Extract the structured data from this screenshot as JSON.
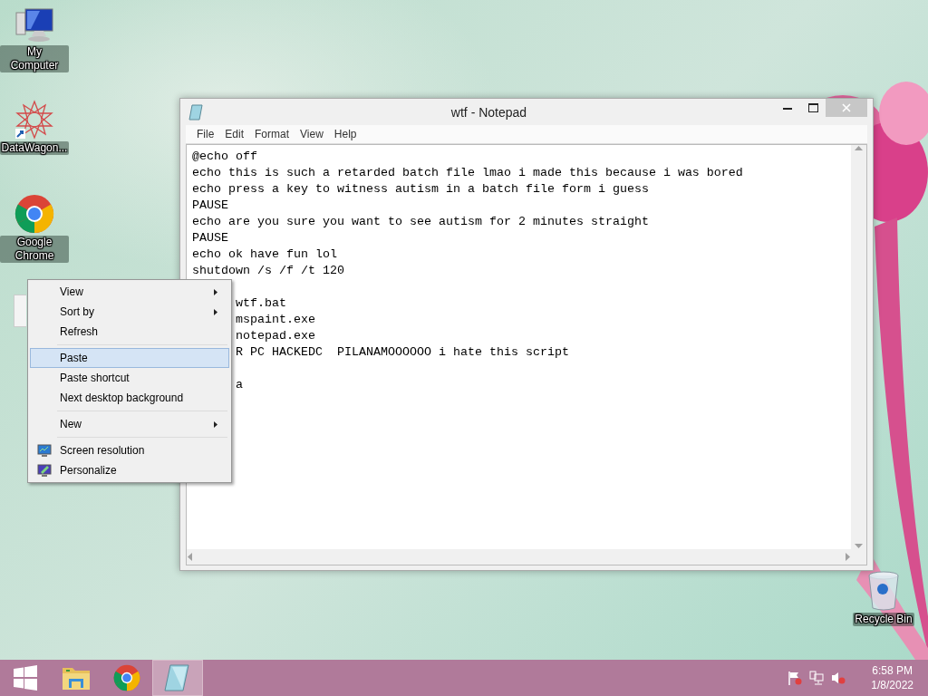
{
  "desktop_icons": [
    {
      "label": "My Computer",
      "kind": "computer"
    },
    {
      "label": "DataWagon...",
      "kind": "star"
    },
    {
      "label": "Google Chrome",
      "kind": "chrome"
    },
    {
      "label": "Recycle Bin",
      "kind": "bin"
    }
  ],
  "notepad": {
    "title": "wtf - Notepad",
    "menu": [
      "File",
      "Edit",
      "Format",
      "View",
      "Help"
    ],
    "lines": [
      {
        "kind": "full",
        "text": "@echo off"
      },
      {
        "kind": "full",
        "text": "echo this is such a retarded batch file lmao i made this because i was bored"
      },
      {
        "kind": "full",
        "text": "echo press a key to witness autism in a batch file form i guess"
      },
      {
        "kind": "full",
        "text": "PAUSE"
      },
      {
        "kind": "full",
        "text": "echo are you sure you want to see autism for 2 minutes straight"
      },
      {
        "kind": "full",
        "text": "PAUSE"
      },
      {
        "kind": "full",
        "text": "echo ok have fun lol"
      },
      {
        "kind": "full",
        "text": "shutdown /s /f /t 120"
      },
      {
        "kind": "covered"
      },
      {
        "kind": "covered",
        "text": "wtf.bat"
      },
      {
        "kind": "covered",
        "text": "mspaint.exe"
      },
      {
        "kind": "covered",
        "text": "notepad.exe"
      },
      {
        "kind": "covered",
        "text": "R PC HACKEDC  PILANAMOOOOOO i hate this script"
      },
      {
        "kind": "covered"
      },
      {
        "kind": "covered",
        "text": "a"
      }
    ]
  },
  "context_menu": [
    {
      "kind": "item",
      "label": "View",
      "submenu": true,
      "selected": false
    },
    {
      "kind": "item",
      "label": "Sort by",
      "submenu": true,
      "selected": false
    },
    {
      "kind": "item",
      "label": "Refresh",
      "submenu": false,
      "selected": false
    },
    {
      "kind": "separator"
    },
    {
      "kind": "item",
      "label": "Paste",
      "submenu": false,
      "selected": true
    },
    {
      "kind": "item",
      "label": "Paste shortcut",
      "submenu": false,
      "selected": false
    },
    {
      "kind": "item",
      "label": "Next desktop background",
      "submenu": false,
      "selected": false
    },
    {
      "kind": "separator"
    },
    {
      "kind": "item",
      "label": "New",
      "submenu": true,
      "selected": false
    },
    {
      "kind": "separator"
    },
    {
      "kind": "monitor_item",
      "label": "Screen resolution",
      "submenu": false,
      "selected": false
    },
    {
      "kind": "paint_item",
      "label": "Personalize",
      "submenu": false,
      "selected": false
    }
  ],
  "taskbar": {
    "apps": [
      {
        "kind": "start",
        "selected": false
      },
      {
        "kind": "folder",
        "selected": false
      },
      {
        "kind": "chrome",
        "selected": false
      },
      {
        "kind": "notepad",
        "selected": true
      }
    ],
    "time": "6:58 PM",
    "date": "1/8/2022"
  }
}
